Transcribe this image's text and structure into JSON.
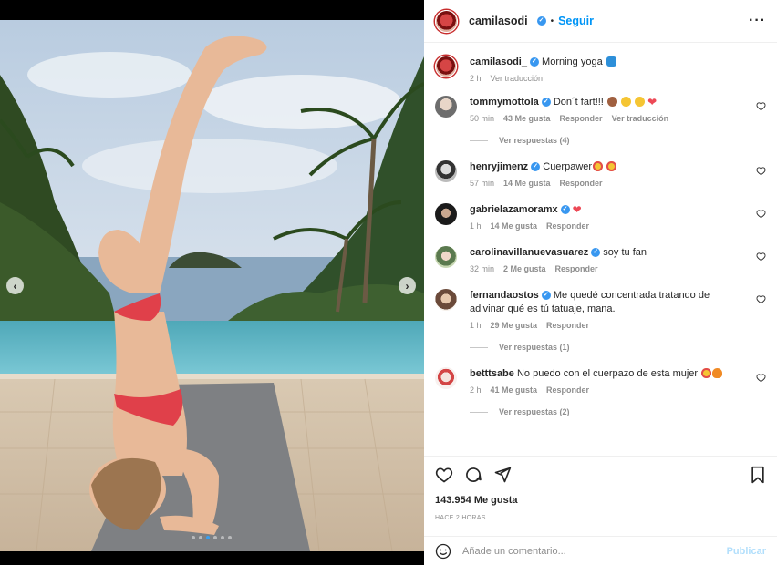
{
  "post": {
    "username": "camilasodi_",
    "follow_label": "Seguir",
    "caption": "Morning yoga",
    "caption_time": "2 h",
    "translate_label": "Ver traducción",
    "likes": "143.954 Me gusta",
    "posted_ago": "HACE 2 HORAS",
    "carousel_total": 6,
    "carousel_active": 3
  },
  "comments": [
    {
      "user": "tommymottola",
      "verified": true,
      "text": "Don´t fart!!!",
      "emojis": [
        "monkey",
        "smile",
        "laugh",
        "heart"
      ],
      "time": "50 min",
      "likes": "43 Me gusta",
      "reply": "Responder",
      "translate": "Ver traducción",
      "replies_label": "Ver respuestas (4)"
    },
    {
      "user": "henryjimenz",
      "verified": true,
      "text": "Cuerpawer",
      "emojis": [
        "star-eyes",
        "star-eyes"
      ],
      "time": "57 min",
      "likes": "14 Me gusta",
      "reply": "Responder",
      "replies_label": ""
    },
    {
      "user": "gabrielazamoramx",
      "verified": true,
      "text": "",
      "emojis": [
        "heart"
      ],
      "time": "1 h",
      "likes": "14 Me gusta",
      "reply": "Responder",
      "replies_label": ""
    },
    {
      "user": "carolinavillanuevasuarez",
      "verified": true,
      "text": "soy tu fan",
      "emojis": [],
      "time": "32 min",
      "likes": "2 Me gusta",
      "reply": "Responder",
      "replies_label": ""
    },
    {
      "user": "fernandaostos",
      "verified": true,
      "text": "Me quedé concentrada tratando de adivinar qué es tú tatuaje, mana.",
      "emojis": [],
      "time": "1 h",
      "likes": "29 Me gusta",
      "reply": "Responder",
      "replies_label": "Ver respuestas (1)"
    },
    {
      "user": "betttsabe",
      "verified": false,
      "text": "No puedo con el cuerpazo de esta mujer",
      "emojis": [
        "star-eyes",
        "fire"
      ],
      "time": "2 h",
      "likes": "41 Me gusta",
      "reply": "Responder",
      "replies_label": "Ver respuestas (2)"
    }
  ],
  "add_comment": {
    "placeholder": "Añade un comentario...",
    "publish_label": "Publicar"
  },
  "colors": {
    "accent": "#0095f6",
    "verified": "#3897f0",
    "heart": "#ed4956",
    "muted": "#8e8e8e"
  }
}
